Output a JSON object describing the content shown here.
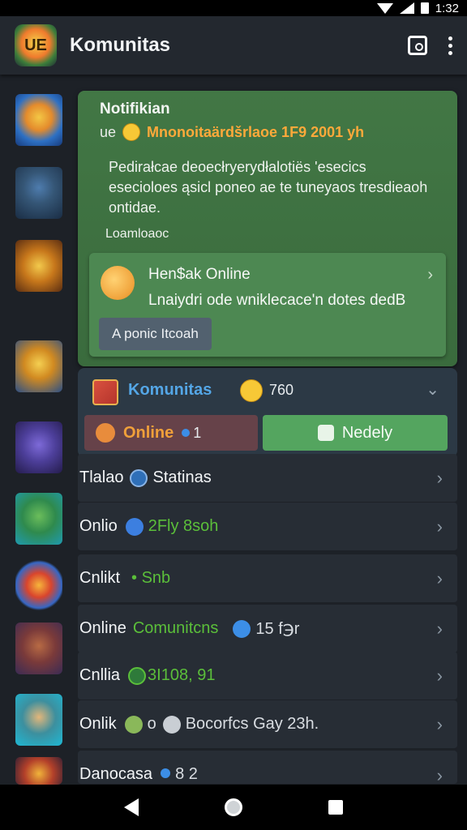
{
  "status_bar": {
    "time": "1:32"
  },
  "app_bar": {
    "title": "Komunitas",
    "logo_text": "UE"
  },
  "notification": {
    "title": "Notifikian",
    "prefix": "ue",
    "highlight": "Mnonoitaärdšrlaoe 1F9 2001 yh",
    "body": "Pedirałcae deoecłryerydłalotiës 'esecics esecioloes ąsicl poneo ae te tuneyaos tresdieaoh ontidae.",
    "link": "Loamloaoc",
    "card": {
      "title": "Hen$ak Online",
      "subtitle": "Lnaiydri ode wniklecace'n dotes dedB",
      "button_label": "A ponic Itcoah"
    }
  },
  "komunitas": {
    "title": "Komunitas",
    "count": "760",
    "online_label": "Online",
    "online_count": "1",
    "nearby_label": "Nedely"
  },
  "rows": [
    {
      "label": "Tlalao",
      "status": "Statinas",
      "extra": ""
    },
    {
      "label": "Onlio",
      "status": "2Fly 8soh",
      "extra": ""
    },
    {
      "label": "Cnlikt",
      "status": "• Snb",
      "extra": ""
    },
    {
      "label": "Online",
      "status": "Comunitcns",
      "extra": "15 f℈r"
    },
    {
      "label": "Cnllia",
      "status": "3I108, 91",
      "extra": ""
    },
    {
      "label": "Onlik",
      "status": "o",
      "extra": "Bocorfcs Gay 23h."
    },
    {
      "label": "Danocasa",
      "status": "8 2",
      "extra": ""
    }
  ],
  "colors": {
    "accent_green": "#54a55f",
    "status_green": "#5bbf3a",
    "komunitas_blue": "#54a6e6",
    "highlight_orange": "#ffa93a"
  }
}
